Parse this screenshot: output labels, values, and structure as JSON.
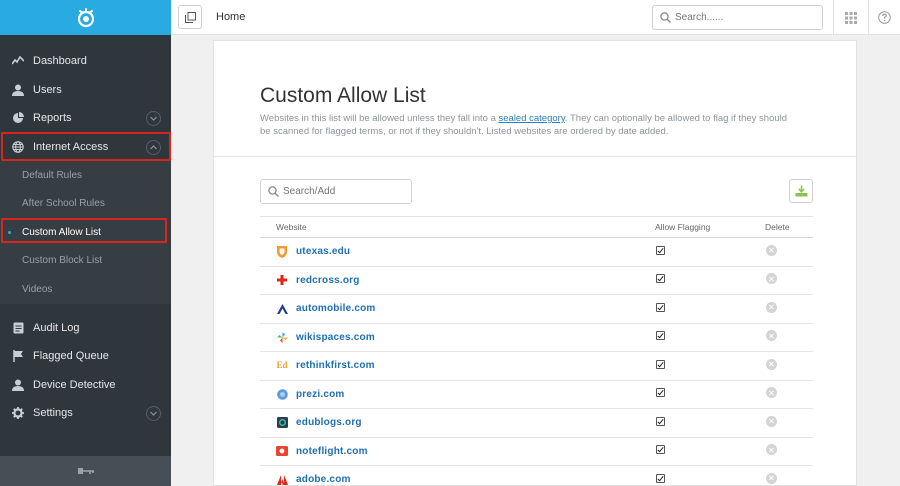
{
  "colors": {
    "brand": "#29abe2",
    "sidebar_bg": "#2f363c",
    "highlight": "#d9251d",
    "link": "#1f6fb3"
  },
  "topbar": {
    "title": "Home",
    "search_placeholder": "Search......"
  },
  "sidebar": {
    "items": [
      {
        "label": "Dashboard",
        "icon": "activity-icon"
      },
      {
        "label": "Users",
        "icon": "user-icon"
      },
      {
        "label": "Reports",
        "icon": "pie-chart-icon"
      },
      {
        "label": "Internet Access",
        "icon": "globe-icon"
      }
    ],
    "sub_items": [
      "Default Rules",
      "After School Rules",
      "Custom Allow List",
      "Custom Block List",
      "Videos"
    ],
    "lower_items": [
      {
        "label": "Audit Log",
        "icon": "document-icon"
      },
      {
        "label": "Flagged Queue",
        "icon": "flag-icon"
      },
      {
        "label": "Device Detective",
        "icon": "user-icon"
      },
      {
        "label": "Settings",
        "icon": "gear-icon"
      }
    ]
  },
  "main": {
    "title": "Custom Allow List",
    "desc_before": "Websites in this list will be allowed unless they fall into a ",
    "desc_link": "sealed category",
    "desc_after": ". They can optionally be allowed to flag if they should be scanned for flagged terms, or not if they shouldn't. Listed websites are ordered by date added.",
    "search_placeholder": "Search/Add",
    "columns": {
      "website": "Website",
      "allow_flagging": "Allow Flagging",
      "delete": "Delete"
    },
    "rows": [
      {
        "site": "utexas.edu",
        "icon": "shield-favicon",
        "flag": true
      },
      {
        "site": "redcross.org",
        "icon": "red-cross-favicon",
        "flag": true
      },
      {
        "site": "automobile.com",
        "icon": "triangle-favicon",
        "flag": true
      },
      {
        "site": "wikispaces.com",
        "icon": "pinwheel-favicon",
        "flag": true
      },
      {
        "site": "rethinkfirst.com",
        "icon": "ed-favicon",
        "flag": true
      },
      {
        "site": "prezi.com",
        "icon": "circle-favicon",
        "flag": true
      },
      {
        "site": "edublogs.org",
        "icon": "e-favicon",
        "flag": true
      },
      {
        "site": "noteflight.com",
        "icon": "note-favicon",
        "flag": true
      },
      {
        "site": "adobe.com",
        "icon": "adobe-favicon",
        "flag": true
      }
    ]
  }
}
